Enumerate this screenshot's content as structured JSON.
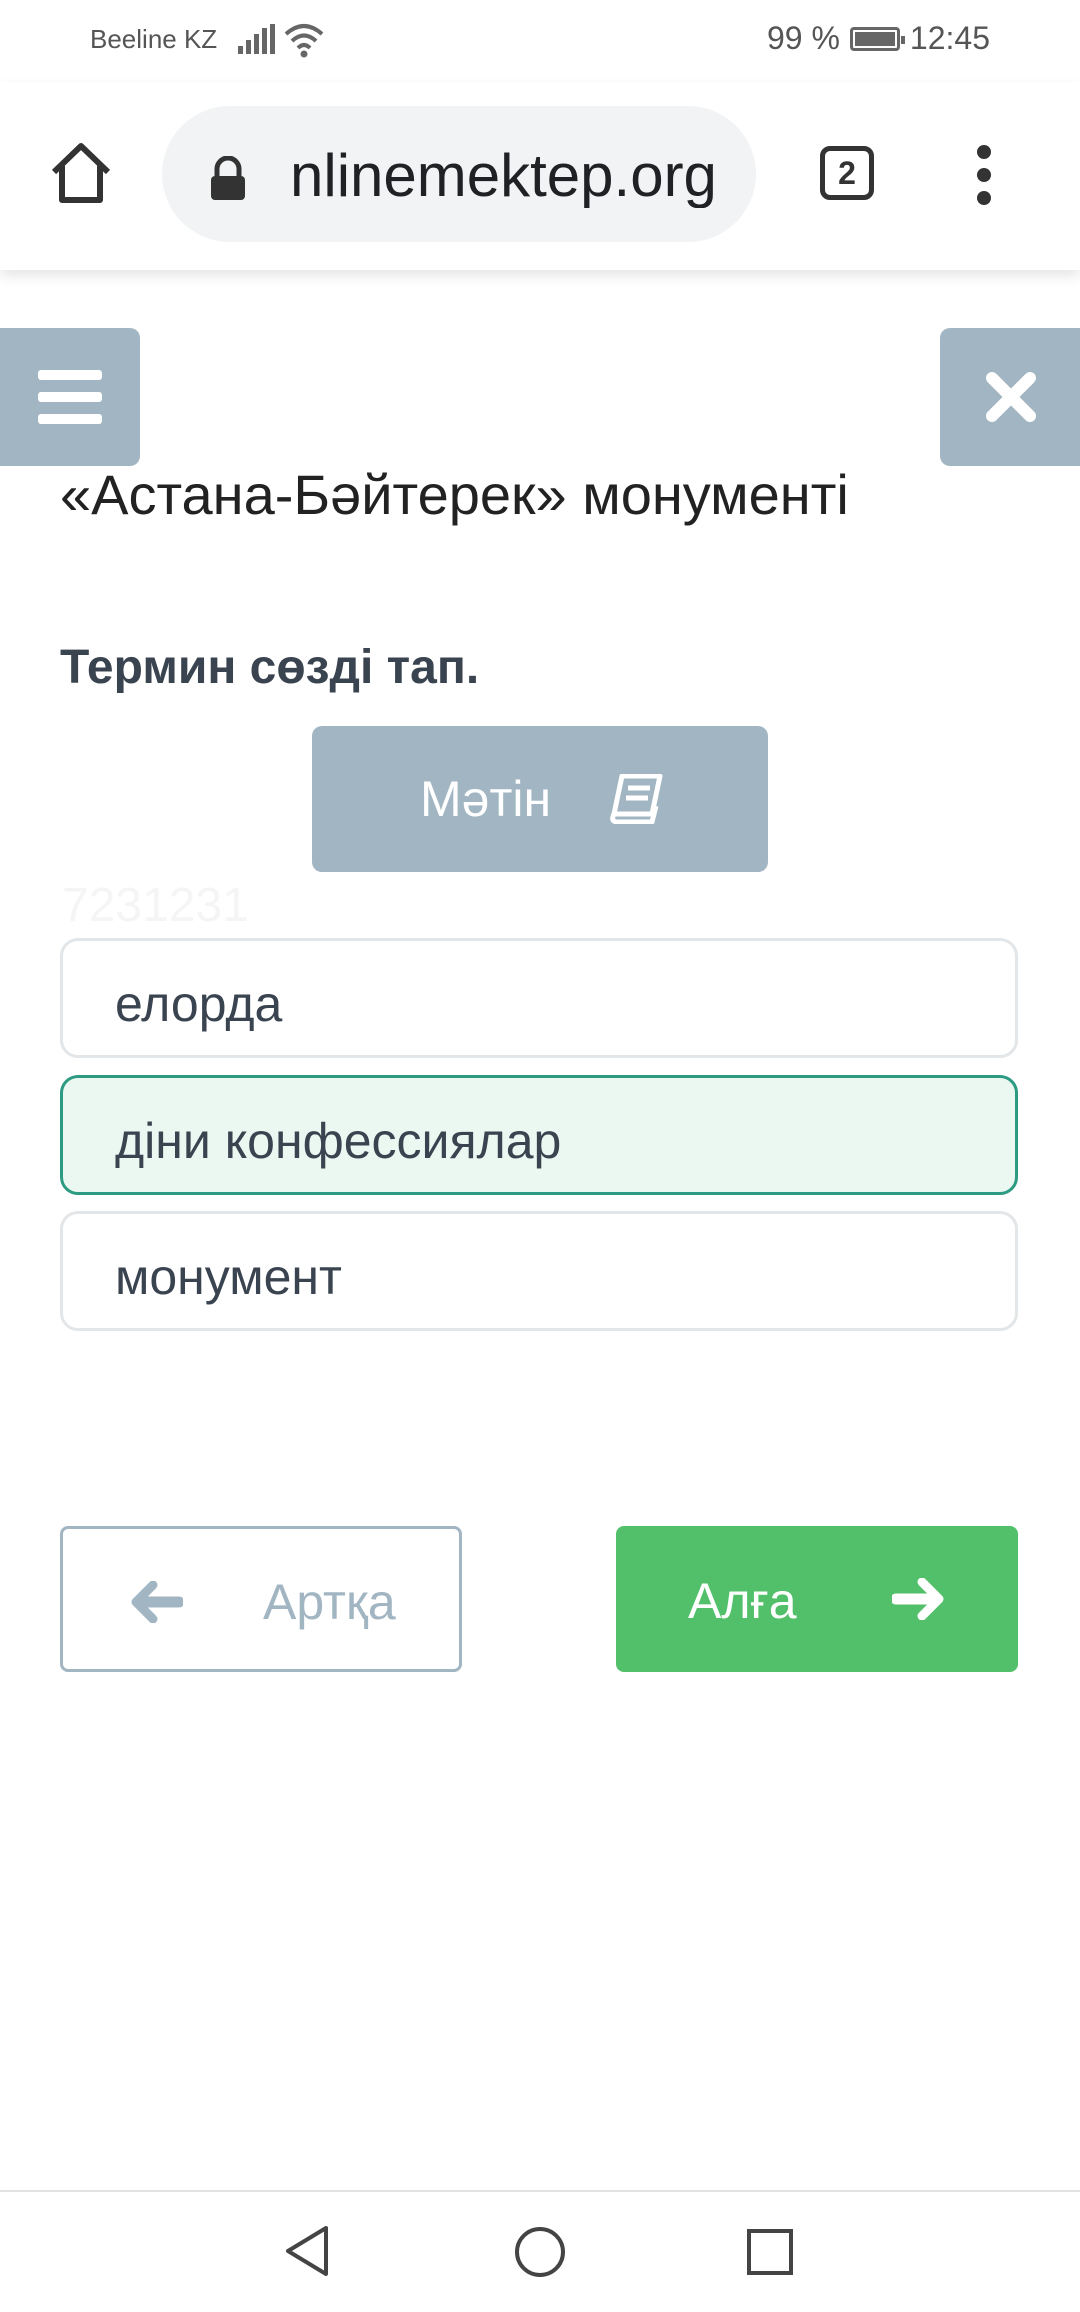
{
  "status_bar": {
    "carrier": "Beeline KZ",
    "battery_percent": "99 %",
    "time": "12:45",
    "icons": [
      "signal-icon",
      "wifi-icon",
      "battery-icon"
    ]
  },
  "browser": {
    "url": "nlinemektep.org",
    "tab_count": "2",
    "icons": [
      "home-icon",
      "lock-icon",
      "tabs-icon",
      "more-vert-icon"
    ]
  },
  "page": {
    "title": "«Астана-Бәйтерек» монументі",
    "question": "Термин сөзді тап.",
    "text_button_label": "Мәтін",
    "watermark": "7231231",
    "options": [
      {
        "label": "елорда",
        "selected": false
      },
      {
        "label": "діни конфессиялар",
        "selected": true
      },
      {
        "label": "монумент",
        "selected": false
      }
    ],
    "back_label": "Артқа",
    "next_label": "Алға"
  },
  "colors": {
    "chrome_gray": "#a2b5c2",
    "selected_bg": "#ebf8f1",
    "selected_border": "#2d9a82",
    "next_green": "#52c06a"
  },
  "system_nav": [
    "back-triangle-icon",
    "home-circle-icon",
    "recents-square-icon"
  ]
}
